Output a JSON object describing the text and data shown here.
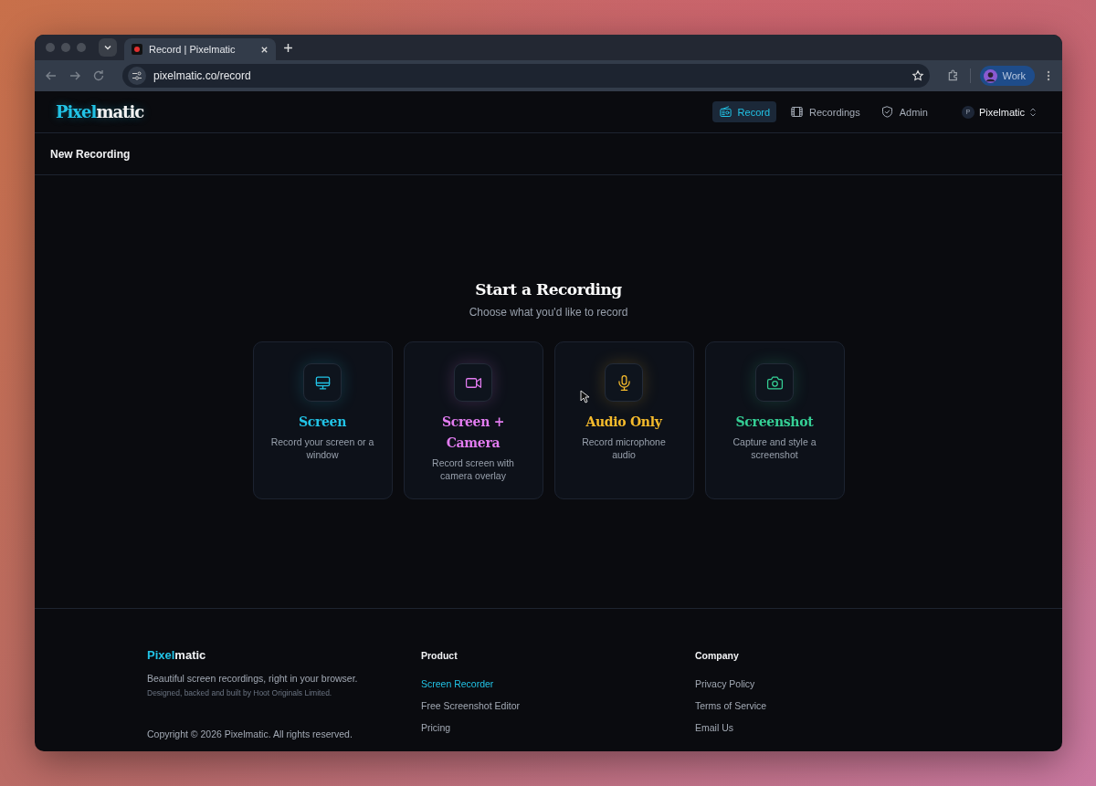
{
  "browser": {
    "tab_title": "Record | Pixelmatic",
    "url": "pixelmatic.co/record",
    "profile": "Work"
  },
  "header": {
    "logo_accent": "Pixel",
    "logo_rest": "matic",
    "nav": [
      {
        "label": "Record",
        "selected": true
      },
      {
        "label": "Recordings",
        "selected": false
      },
      {
        "label": "Admin",
        "selected": false
      }
    ],
    "account": {
      "initial": "P",
      "name": "Pixelmatic"
    }
  },
  "page_title": "New Recording",
  "main": {
    "title": "Start a Recording",
    "subtitle": "Choose what you'd like to record",
    "cards": [
      {
        "title": "Screen",
        "description": "Record your screen or a window",
        "color": "#22c3e6"
      },
      {
        "title": "Screen + Camera",
        "description": "Record screen with camera overlay",
        "color": "#e27cf0"
      },
      {
        "title": "Audio Only",
        "description": "Record microphone audio",
        "color": "#f6bb2c"
      },
      {
        "title": "Screenshot",
        "description": "Capture and style a screenshot",
        "color": "#35cf95"
      }
    ]
  },
  "footer": {
    "brand_accent": "Pixel",
    "brand_rest": "matic",
    "tagline": "Beautiful screen recordings, right in your browser.",
    "credit": "Designed, backed and built by Hoot Originals Limited.",
    "copyright": "Copyright © 2026 Pixelmatic. All rights reserved.",
    "columns": [
      {
        "heading": "Product",
        "links": [
          {
            "label": "Screen Recorder",
            "selected": true
          },
          {
            "label": "Free Screenshot Editor",
            "selected": false
          },
          {
            "label": "Pricing",
            "selected": false
          }
        ]
      },
      {
        "heading": "Company",
        "links": [
          {
            "label": "Privacy Policy",
            "selected": false
          },
          {
            "label": "Terms of Service",
            "selected": false
          },
          {
            "label": "Email Us",
            "selected": false
          }
        ]
      }
    ]
  }
}
